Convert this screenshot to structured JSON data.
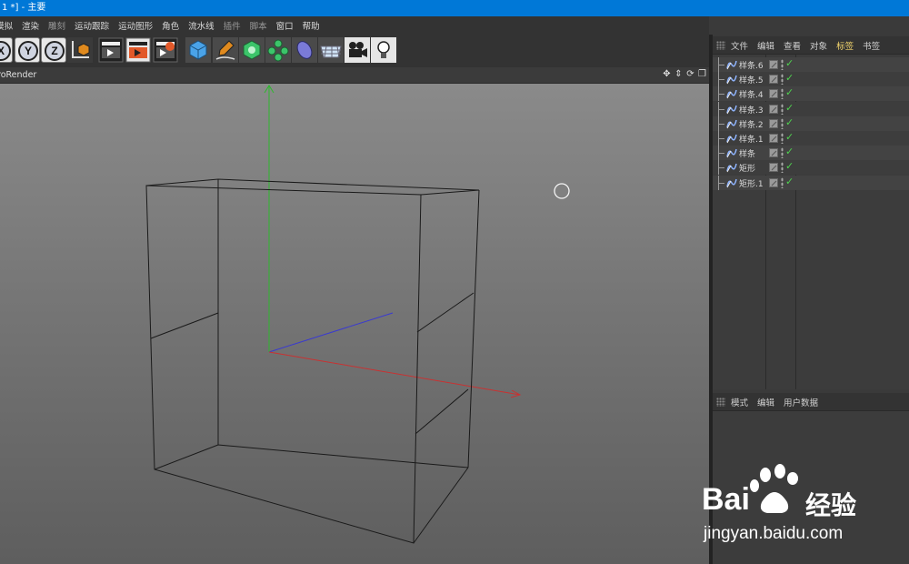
{
  "window": {
    "title": "1 *] - 主要"
  },
  "menu": {
    "items": [
      "模拟",
      "渲染",
      "雕刻",
      "运动跟踪",
      "运动图形",
      "角色",
      "流水线",
      "插件",
      "脚本",
      "窗口",
      "帮助"
    ]
  },
  "toolbar": {
    "axis_x": "X",
    "axis_y": "Y",
    "axis_z": "Z",
    "icons": [
      "x-axis-lock-icon",
      "y-axis-lock-icon",
      "z-axis-lock-icon",
      "coordinate-system-icon",
      "render-view-icon",
      "render-picture-viewer-icon",
      "render-settings-icon",
      "cube-icon",
      "pen-spline-icon",
      "subdivision-icon",
      "cloner-icon",
      "deformer-icon",
      "floor-grid-icon",
      "camera-icon",
      "light-icon"
    ]
  },
  "viewport": {
    "title": "roRender",
    "icons": [
      "move-view-icon",
      "scale-view-icon",
      "rotate-view-icon",
      "maximize-view-icon"
    ]
  },
  "object_manager": {
    "tabs": [
      "文件",
      "编辑",
      "查看",
      "对象",
      "标签",
      "书签"
    ],
    "active_tab": "标签",
    "objects": [
      {
        "name": "样条.6",
        "icon": "spline-icon"
      },
      {
        "name": "样条.5",
        "icon": "spline-icon"
      },
      {
        "name": "样条.4",
        "icon": "spline-icon"
      },
      {
        "name": "样条.3",
        "icon": "spline-icon"
      },
      {
        "name": "样条.2",
        "icon": "spline-icon"
      },
      {
        "name": "样条.1",
        "icon": "spline-icon"
      },
      {
        "name": "样条",
        "icon": "spline-icon"
      },
      {
        "name": "矩形",
        "icon": "spline-icon"
      },
      {
        "name": "矩形.1",
        "icon": "spline-icon"
      }
    ]
  },
  "attribute_manager": {
    "tabs": [
      "模式",
      "编辑",
      "用户数据"
    ]
  },
  "watermark": {
    "brand_left": "Bai",
    "brand_right": "经验",
    "url": "jingyan.baidu.com"
  },
  "colors": {
    "title_bar": "#0078d7",
    "active_tab": "#f5d76e",
    "axis_x": "#c83232",
    "axis_y": "#32b432",
    "axis_z": "#3232c8",
    "check": "#4fd14f"
  }
}
